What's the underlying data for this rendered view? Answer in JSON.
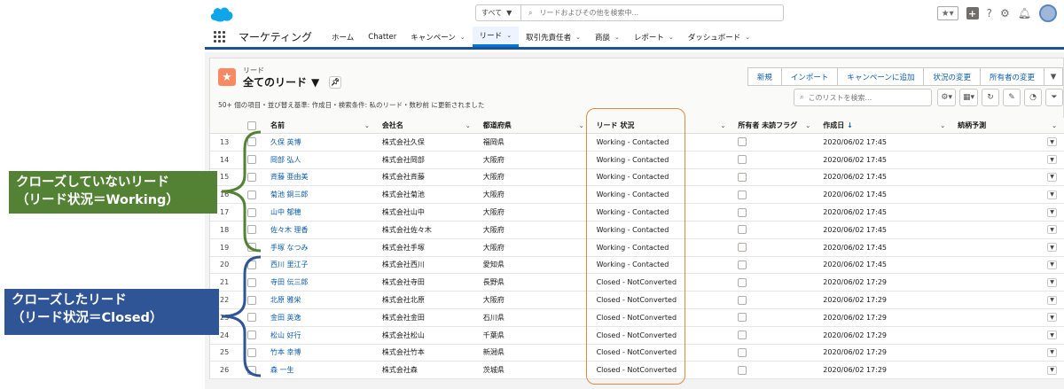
{
  "header": {
    "search_scope": "すべて",
    "search_placeholder": "リードおよびその他を検索中..."
  },
  "nav": {
    "app_name": "マーケティング",
    "items": [
      {
        "label": "ホーム",
        "chevron": false,
        "active": false
      },
      {
        "label": "Chatter",
        "chevron": false,
        "active": false
      },
      {
        "label": "キャンペーン",
        "chevron": true,
        "active": false
      },
      {
        "label": "リード",
        "chevron": true,
        "active": true
      },
      {
        "label": "取引先責任者",
        "chevron": true,
        "active": false
      },
      {
        "label": "商談",
        "chevron": true,
        "active": false
      },
      {
        "label": "レポート",
        "chevron": true,
        "active": false
      },
      {
        "label": "ダッシュボード",
        "chevron": true,
        "active": false
      }
    ]
  },
  "list": {
    "object_label": "リード",
    "view_name": "全てのリード",
    "meta": "50+ 個の項目・並び替え基準: 作成日・検索条件: 私のリード・数秒前 に更新されました",
    "actions": [
      "新規",
      "インポート",
      "キャンペーンに追加",
      "状況の変更",
      "所有者の変更"
    ],
    "search_placeholder": "このリストを検索..."
  },
  "table": {
    "columns": [
      "名前",
      "会社名",
      "都道府県",
      "リード 状況",
      "所有者 未読フラグ",
      "作成日",
      "続柄予測"
    ],
    "rows": [
      {
        "n": "13",
        "name": "久保 英博",
        "company": "株式会社久保",
        "pref": "福岡県",
        "status": "Working - Contacted",
        "date": "2020/06/02 17:45"
      },
      {
        "n": "14",
        "name": "岡部 弘人",
        "company": "株式会社岡部",
        "pref": "大阪府",
        "status": "Working - Contacted",
        "date": "2020/06/02 17:45"
      },
      {
        "n": "15",
        "name": "斉藤 亜由美",
        "company": "株式会社斉藤",
        "pref": "大阪府",
        "status": "Working - Contacted",
        "date": "2020/06/02 17:45"
      },
      {
        "n": "16",
        "name": "菊池 銅三郎",
        "company": "株式会社菊池",
        "pref": "大阪府",
        "status": "Working - Contacted",
        "date": "2020/06/02 17:45"
      },
      {
        "n": "17",
        "name": "山中 郁穂",
        "company": "株式会社山中",
        "pref": "大阪府",
        "status": "Working - Contacted",
        "date": "2020/06/02 17:45"
      },
      {
        "n": "18",
        "name": "佐々木 理香",
        "company": "株式会社佐々木",
        "pref": "大阪府",
        "status": "Working - Contacted",
        "date": "2020/06/02 17:45"
      },
      {
        "n": "19",
        "name": "手塚 なつみ",
        "company": "株式会社手塚",
        "pref": "大阪府",
        "status": "Working - Contacted",
        "date": "2020/06/02 17:45"
      },
      {
        "n": "20",
        "name": "西川 里江子",
        "company": "株式会社西川",
        "pref": "愛知県",
        "status": "Working - Contacted",
        "date": "2020/06/02 17:45"
      },
      {
        "n": "21",
        "name": "寺田 伝三郎",
        "company": "株式会社寺田",
        "pref": "長野県",
        "status": "Closed - NotConverted",
        "date": "2020/06/02 17:29"
      },
      {
        "n": "22",
        "name": "北原 雅栄",
        "company": "株式会社北原",
        "pref": "大阪府",
        "status": "Closed - NotConverted",
        "date": "2020/06/02 17:29"
      },
      {
        "n": "23",
        "name": "金田 英逸",
        "company": "株式会社金田",
        "pref": "石川県",
        "status": "Closed - NotConverted",
        "date": "2020/06/02 17:29"
      },
      {
        "n": "24",
        "name": "松山 好行",
        "company": "株式会社松山",
        "pref": "千葉県",
        "status": "Closed - NotConverted",
        "date": "2020/06/02 17:29"
      },
      {
        "n": "25",
        "name": "竹本 幸博",
        "company": "株式会社竹本",
        "pref": "新潟県",
        "status": "Closed - NotConverted",
        "date": "2020/06/02 17:29"
      },
      {
        "n": "26",
        "name": "森 一生",
        "company": "株式会社森",
        "pref": "茨城県",
        "status": "Closed - NotConverted",
        "date": "2020/06/02 17:29"
      }
    ]
  },
  "annotations": {
    "working_line1": "クローズしていないリード",
    "working_line2": "（リード状況＝Working）",
    "closed_line1": "クローズしたリード",
    "closed_line2": "（リード状況＝Closed）"
  },
  "colors": {
    "brand_blue": "#0176d3",
    "nav_border": "#1b5297",
    "lead_icon": "#f88962",
    "callout_green": "#548235",
    "callout_blue": "#2f5597",
    "status_frame": "#e08a3c"
  }
}
